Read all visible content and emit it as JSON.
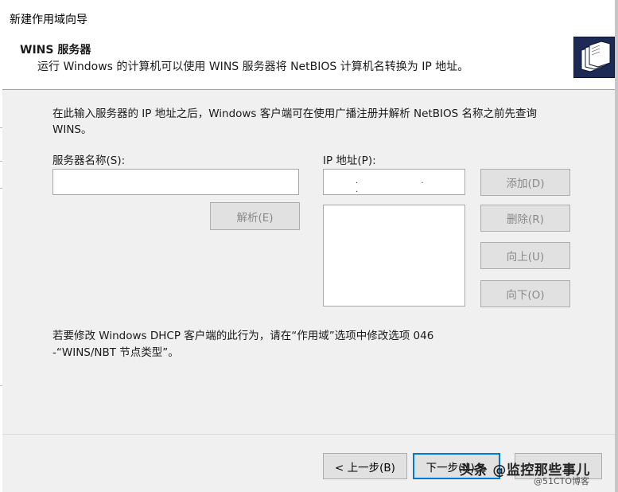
{
  "window": {
    "title": "新建作用域向导"
  },
  "header": {
    "title": "WINS 服务器",
    "subtitle": "运行 Windows 的计算机可以使用 WINS 服务器将 NetBIOS 计算机名转换为 IP 地址。",
    "icon": "wizard-folders-icon"
  },
  "description": "在此输入服务器的 IP 地址之后，Windows 客户端可在使用广播注册并解析 NetBIOS 名称之前先查询 WINS。",
  "fields": {
    "server_name_label": "服务器名称(S):",
    "server_name_value": "",
    "ip_label": "IP 地址(P):",
    "ip_value": ". . ."
  },
  "buttons": {
    "resolve": "解析(E)",
    "add": "添加(D)",
    "remove": "删除(R)",
    "up": "向上(U)",
    "down": "向下(O)",
    "back": "< 上一步(B)",
    "next": "下一步(N) >"
  },
  "note": "若要修改 Windows DHCP 客户端的此行为，请在“作用域”选项中修改选项 046 -“WINS/NBT 节点类型”。",
  "watermark": {
    "main": "头条 @监控那些事儿",
    "sub": "@51CTO博客"
  },
  "colors": {
    "accent": "#0078d7",
    "dialog_bg": "#f0f0f0",
    "header_bg": "#ffffff",
    "icon_bg": "#1c2a55"
  }
}
